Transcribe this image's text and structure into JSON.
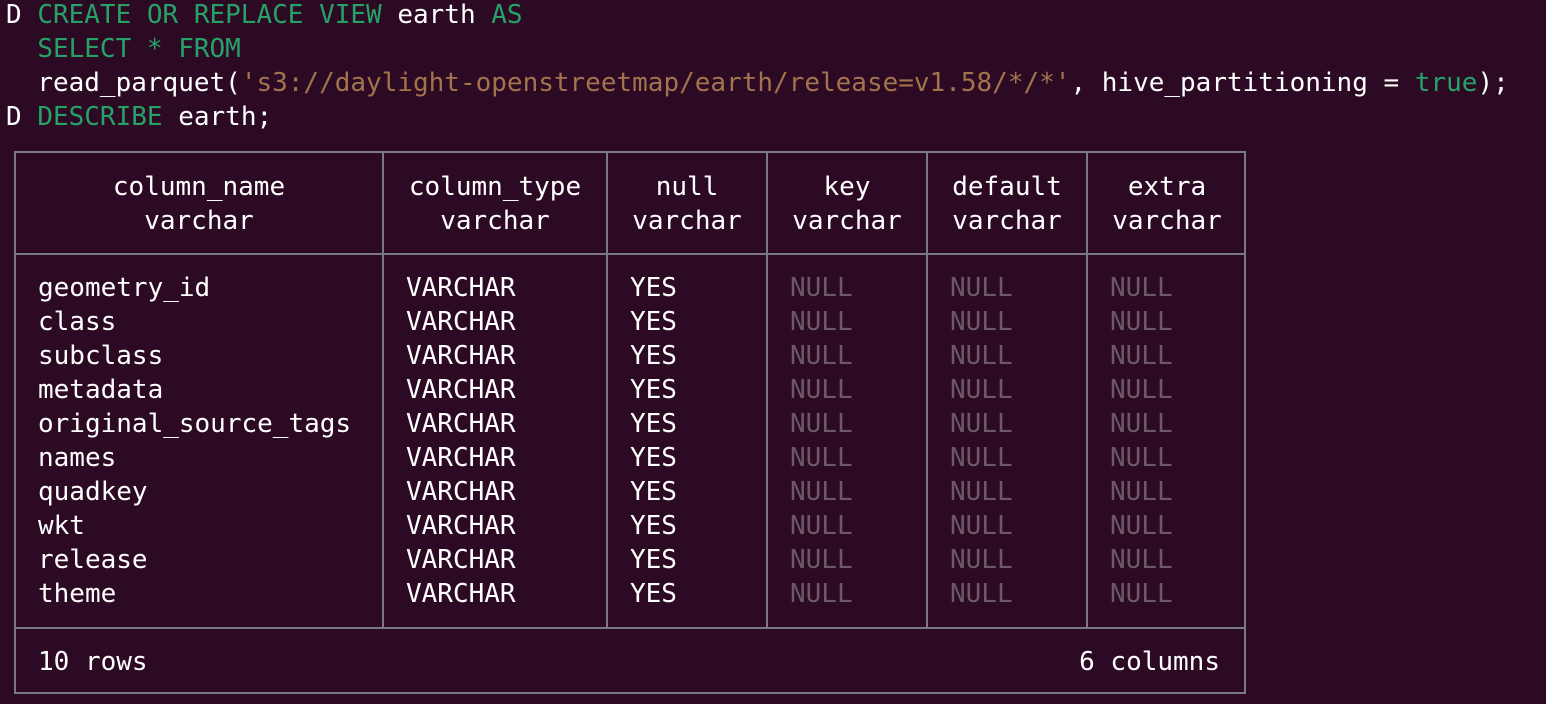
{
  "prompt": "D",
  "sql": {
    "line1": {
      "kw1": "CREATE OR REPLACE VIEW",
      "ident": " earth ",
      "kw2": "AS"
    },
    "line2": {
      "kw": "SELECT * FROM"
    },
    "line3": {
      "fn": "read_parquet(",
      "str": "'s3://daylight-openstreetmap/earth/release=v1.58/*/*'",
      "mid": ", hive_partitioning = ",
      "bool": "true",
      "end": ");"
    },
    "line4": {
      "kw": "DESCRIBE",
      "rest": " earth;"
    }
  },
  "table": {
    "headers": [
      {
        "name": "column_name",
        "type": "varchar"
      },
      {
        "name": "column_type",
        "type": "varchar"
      },
      {
        "name": "null",
        "type": "varchar"
      },
      {
        "name": "key",
        "type": "varchar"
      },
      {
        "name": "default",
        "type": "varchar"
      },
      {
        "name": "extra",
        "type": "varchar"
      }
    ],
    "rows": [
      [
        "geometry_id",
        "VARCHAR",
        "YES",
        "NULL",
        "NULL",
        "NULL"
      ],
      [
        "class",
        "VARCHAR",
        "YES",
        "NULL",
        "NULL",
        "NULL"
      ],
      [
        "subclass",
        "VARCHAR",
        "YES",
        "NULL",
        "NULL",
        "NULL"
      ],
      [
        "metadata",
        "VARCHAR",
        "YES",
        "NULL",
        "NULL",
        "NULL"
      ],
      [
        "original_source_tags",
        "VARCHAR",
        "YES",
        "NULL",
        "NULL",
        "NULL"
      ],
      [
        "names",
        "VARCHAR",
        "YES",
        "NULL",
        "NULL",
        "NULL"
      ],
      [
        "quadkey",
        "VARCHAR",
        "YES",
        "NULL",
        "NULL",
        "NULL"
      ],
      [
        "wkt",
        "VARCHAR",
        "YES",
        "NULL",
        "NULL",
        "NULL"
      ],
      [
        "release",
        "VARCHAR",
        "YES",
        "NULL",
        "NULL",
        "NULL"
      ],
      [
        "theme",
        "VARCHAR",
        "YES",
        "NULL",
        "NULL",
        "NULL"
      ]
    ],
    "footer_left": "10 rows",
    "footer_right": "6 columns"
  },
  "colors": {
    "background": "#2c0a23",
    "keyword": "#26a269",
    "string": "#a2734c",
    "null_value": "#6b5a66",
    "border": "#7a7a82"
  }
}
